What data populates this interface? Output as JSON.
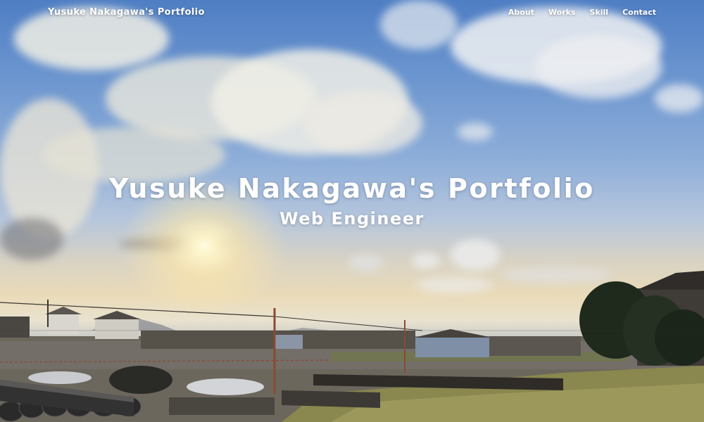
{
  "header": {
    "logo": "Yusuke Nakagawa's Portfolio",
    "nav": [
      {
        "label": "About"
      },
      {
        "label": "Works"
      },
      {
        "label": "Skill"
      },
      {
        "label": "Contact"
      }
    ]
  },
  "hero": {
    "title": "Yusuke Nakagawa's Portfolio",
    "subtitle": "Web Engineer"
  },
  "colors": {
    "text": "#ffffff",
    "sky_top": "#4f7ec4",
    "sunset": "#eadbb8"
  }
}
